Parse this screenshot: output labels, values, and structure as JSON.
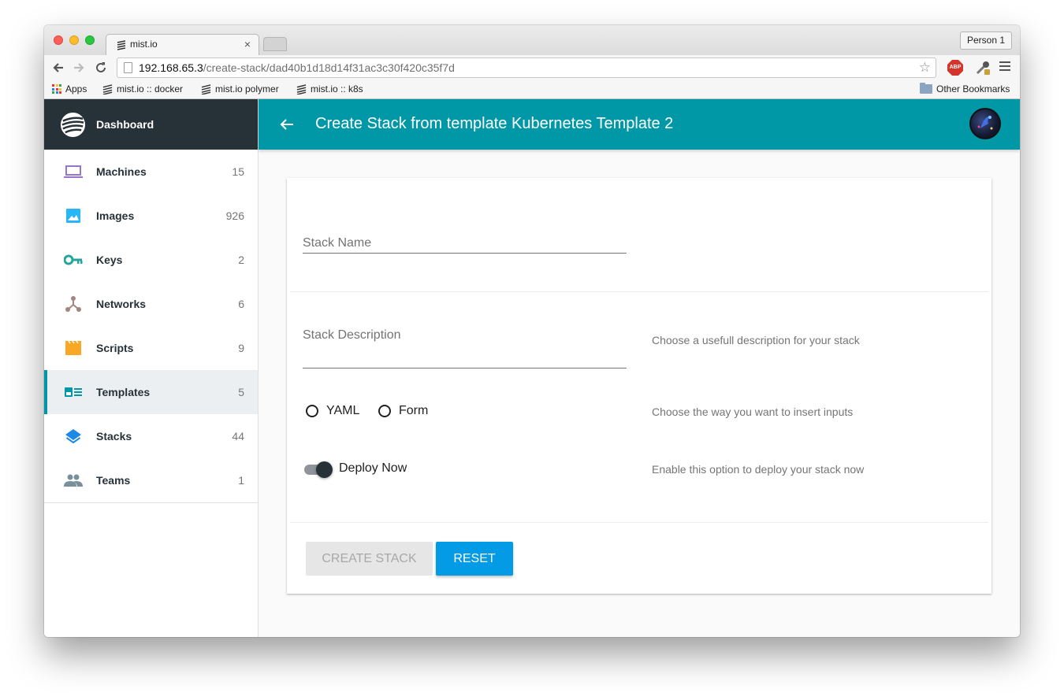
{
  "browser": {
    "tab_title": "mist.io",
    "tab_close": "×",
    "profile": "Person 1",
    "url_host": "192.168.65.3",
    "url_path": "/create-stack/dad40b1d18d14f31ac3c30f420c35f7d",
    "extension_badge": "ABP",
    "bookmarks": [
      {
        "label": "Apps",
        "icon": "apps-icon"
      },
      {
        "label": "mist.io :: docker",
        "icon": "mist-logo-icon"
      },
      {
        "label": "mist.io polymer",
        "icon": "mist-logo-icon"
      },
      {
        "label": "mist.io :: k8s",
        "icon": "mist-logo-icon"
      }
    ],
    "other_bookmarks": "Other Bookmarks"
  },
  "sidebar": {
    "header": "Dashboard",
    "active_color": "#0096aa",
    "items": [
      {
        "label": "Machines",
        "count": "15",
        "icon": "laptop-icon",
        "color": "#9575cd"
      },
      {
        "label": "Images",
        "count": "926",
        "icon": "image-icon",
        "color": "#29b6f6"
      },
      {
        "label": "Keys",
        "count": "2",
        "icon": "key-icon",
        "color": "#26a69a"
      },
      {
        "label": "Networks",
        "count": "6",
        "icon": "network-icon",
        "color": "#a1887f"
      },
      {
        "label": "Scripts",
        "count": "9",
        "icon": "script-icon",
        "color": "#f9a825"
      },
      {
        "label": "Templates",
        "count": "5",
        "icon": "template-icon",
        "color": "#0097a7",
        "active": true
      },
      {
        "label": "Stacks",
        "count": "44",
        "icon": "stacks-icon",
        "color": "#1e88e5"
      },
      {
        "label": "Teams",
        "count": "1",
        "icon": "teams-icon",
        "color": "#78909c"
      }
    ]
  },
  "topbar": {
    "title": "Create Stack from template Kubernetes Template 2",
    "color": "#0097a7"
  },
  "form": {
    "stack_name_label": "Stack Name",
    "stack_description_label": "Stack Description",
    "stack_description_help": "Choose a usefull description for your stack",
    "input_mode_options": [
      "YAML",
      "Form"
    ],
    "input_mode_help": "Choose the way you want to insert inputs",
    "deploy_now_label": "Deploy Now",
    "deploy_now_on": true,
    "deploy_now_help": "Enable this option to deploy your stack now",
    "create_button": "CREATE STACK",
    "reset_button": "RESET"
  }
}
